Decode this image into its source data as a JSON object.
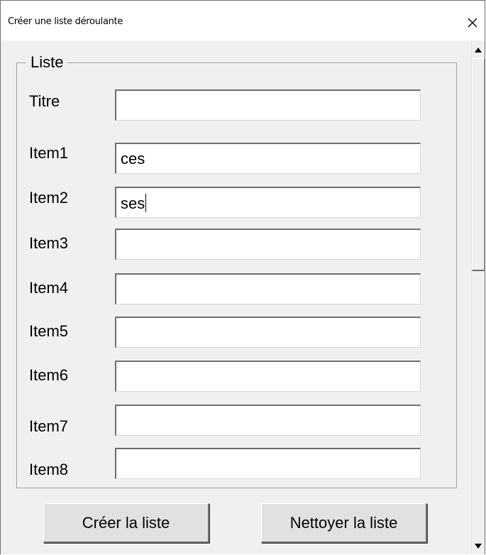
{
  "window": {
    "title": "Créer une liste déroulante",
    "close_icon": "close-icon"
  },
  "group": {
    "legend": "Liste"
  },
  "fields": [
    {
      "label": "Titre",
      "value": ""
    },
    {
      "label": "Item1",
      "value": "ces"
    },
    {
      "label": "Item2",
      "value": "ses"
    },
    {
      "label": "Item3",
      "value": ""
    },
    {
      "label": "Item4",
      "value": ""
    },
    {
      "label": "Item5",
      "value": ""
    },
    {
      "label": "Item6",
      "value": ""
    },
    {
      "label": "Item7",
      "value": ""
    },
    {
      "label": "Item8",
      "value": ""
    }
  ],
  "buttons": {
    "create_label": "Créer la liste",
    "clear_label": "Nettoyer la liste"
  },
  "scrollbar": {
    "up_icon": "scroll-up-arrow-icon",
    "down_icon": "scroll-down-arrow-icon"
  }
}
